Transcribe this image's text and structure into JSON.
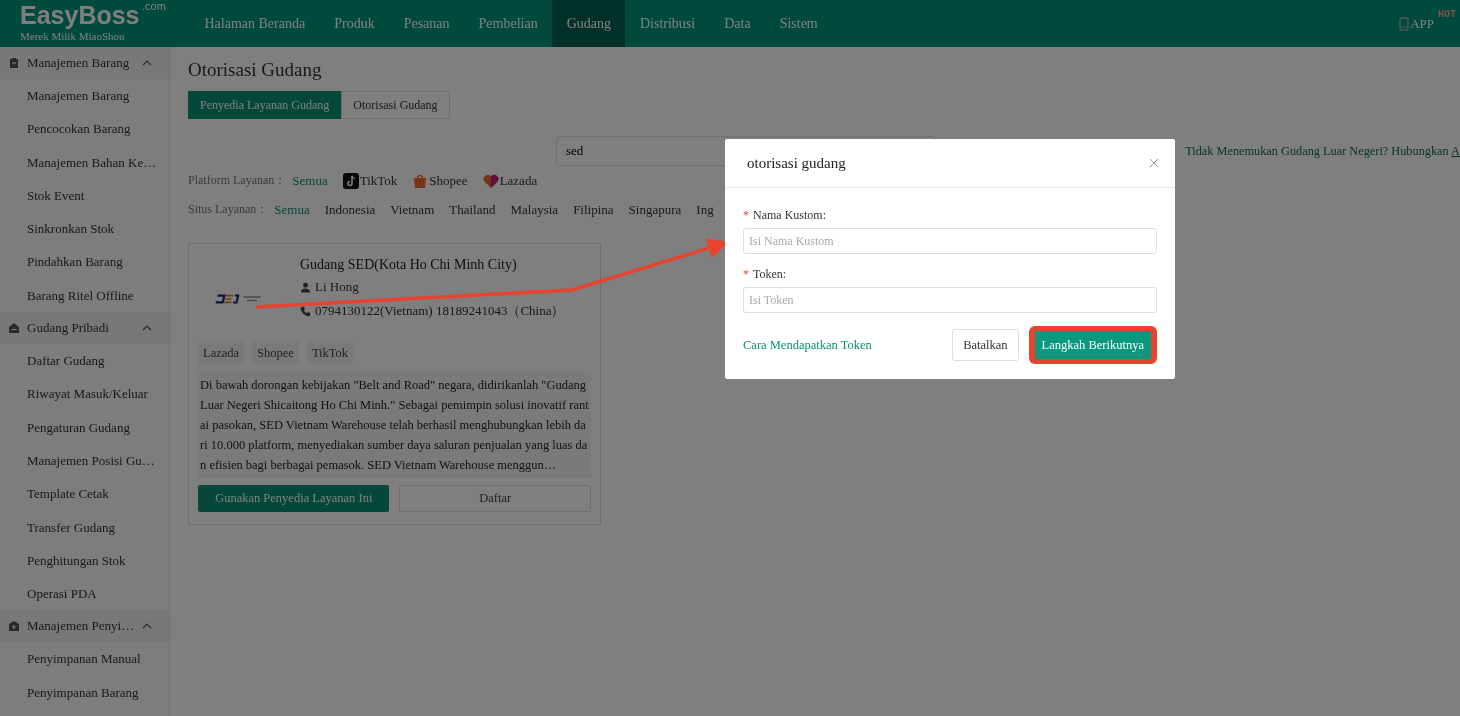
{
  "header": {
    "logo": "EasyBoss",
    "logo_suffix": ".com",
    "logo_tagline": "Merek Milik MiaoShou",
    "nav": [
      {
        "label": "Halaman Beranda",
        "selected": false
      },
      {
        "label": "Produk",
        "selected": false
      },
      {
        "label": "Pesanan",
        "selected": false
      },
      {
        "label": "Pembelian",
        "selected": false
      },
      {
        "label": "Gudang",
        "selected": true
      },
      {
        "label": "Distribusi",
        "selected": false
      },
      {
        "label": "Data",
        "selected": false
      },
      {
        "label": "Sistem",
        "selected": false
      }
    ],
    "app_label": "APP",
    "app_badge": "HOT"
  },
  "sidebar": {
    "groups": [
      {
        "label": "Manajemen Barang",
        "kind": "goods",
        "expanded": true,
        "children": [
          {
            "label": "Manajemen Barang"
          },
          {
            "label": "Pencocokan Barang"
          },
          {
            "label": "Manajemen Bahan Ke…"
          },
          {
            "label": "Stok Event"
          },
          {
            "label": "Sinkronkan Stok"
          },
          {
            "label": "Pindahkan Barang"
          },
          {
            "label": "Barang Ritel Offline"
          }
        ]
      },
      {
        "label": "Gudang Pribadi",
        "kind": "warehouse",
        "expanded": true,
        "children": [
          {
            "label": "Daftar Gudang"
          },
          {
            "label": "Riwayat Masuk/Keluar"
          },
          {
            "label": "Pengaturan Gudang"
          },
          {
            "label": "Manajemen Posisi Gu…"
          },
          {
            "label": "Template Cetak"
          },
          {
            "label": "Transfer Gudang"
          },
          {
            "label": "Penghitungan Stok"
          },
          {
            "label": "Operasi PDA"
          }
        ]
      },
      {
        "label": "Manajemen Penyi…",
        "kind": "storage",
        "expanded": true,
        "children": [
          {
            "label": "Penyimpanan Manual"
          },
          {
            "label": "Penyimpanan Barang"
          }
        ]
      }
    ]
  },
  "page": {
    "title": "Otorisasi Gudang",
    "tabs": [
      {
        "label": "Penyedia Layanan Gudang",
        "selected": true
      },
      {
        "label": "Otorisasi Gudang",
        "selected": false
      }
    ],
    "search": {
      "value": "sed"
    },
    "help_text": "Tidak Menemukan Gudang Luar Negeri? Hubungkan",
    "help_link": "A"
  },
  "filters": [
    {
      "label": "Platform Layanan：",
      "options": [
        {
          "label": "Semua",
          "selected": true,
          "kind": "plain"
        },
        {
          "label": "TikTok",
          "selected": false,
          "kind": "tiktok"
        },
        {
          "label": "Shopee",
          "selected": false,
          "kind": "shopee"
        },
        {
          "label": "Lazada",
          "selected": false,
          "kind": "lazada"
        }
      ]
    },
    {
      "label": "Situs Layanan：",
      "options": [
        {
          "label": "Semua",
          "selected": true,
          "kind": "plain"
        },
        {
          "label": "Indonesia",
          "selected": false,
          "kind": "plain"
        },
        {
          "label": "Vietnam",
          "selected": false,
          "kind": "plain"
        },
        {
          "label": "Thailand",
          "selected": false,
          "kind": "plain"
        },
        {
          "label": "Malaysia",
          "selected": false,
          "kind": "plain"
        },
        {
          "label": "Filipina",
          "selected": false,
          "kind": "plain"
        },
        {
          "label": "Singapura",
          "selected": false,
          "kind": "plain"
        },
        {
          "label": "Ing",
          "selected": false,
          "kind": "plain"
        }
      ]
    }
  ],
  "card": {
    "name": "Gudang SED(Kota Ho Chi Minh City)",
    "contact": "Li Hong",
    "phone": "0794130122(Vietnam) 18189241043（China）",
    "tags": [
      "Lazada",
      "Shopee",
      "TikTok"
    ],
    "description": "Di bawah dorongan kebijakan \"Belt and Road\" negara, didirikanlah \"Gudang Luar Negeri Shicaitong Ho Chi Minh.\" Sebagai pemimpin solusi inovatif rantai pasokan, SED Vietnam Warehouse telah berhasil menghubungkan lebih dari 10.000 platform, menyediakan sumber daya saluran penjualan yang luas dan efisien bagi berbagai pemasok. SED Vietnam Warehouse menggun…",
    "primary_button": "Gunakan Penyedia Layanan Ini",
    "secondary_button": "Daftar"
  },
  "dialog": {
    "title": "otorisasi gudang",
    "fields": [
      {
        "label": "Nama Kustom:",
        "required_mark": "*",
        "placeholder": "Isi Nama Kustom"
      },
      {
        "label": "Token:",
        "required_mark": "*",
        "placeholder": "Isi Token"
      }
    ],
    "help_link": "Cara Mendapatkan Token",
    "cancel": "Batalkan",
    "next": "Langkah Berikutnya",
    "next_highlighted": true
  }
}
